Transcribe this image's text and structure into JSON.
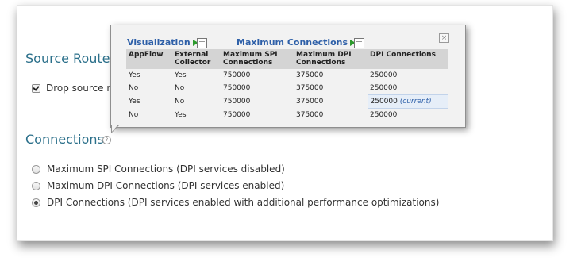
{
  "sections": {
    "source_routed": {
      "title": "Source Routed Pa",
      "checkbox_label": "Drop source routed packets",
      "checked": true
    },
    "connections": {
      "title": "Connections",
      "help_icon": "help-icon",
      "options": [
        {
          "label": "Maximum SPI Connections (DPI services disabled)",
          "selected": false
        },
        {
          "label": "Maximum DPI Connections (DPI services enabled)",
          "selected": false
        },
        {
          "label": "DPI Connections (DPI services enabled with additional performance optimizations)",
          "selected": true
        }
      ]
    }
  },
  "popup": {
    "links": {
      "visualization": "Visualization",
      "maximum_connections": "Maximum Connections"
    },
    "export_icon": "export-icon",
    "close_glyph": "×",
    "table": {
      "headers": [
        "AppFlow",
        "External Collector",
        "Maximum SPI Connections",
        "Maximum DPI Connections",
        "DPI Connections"
      ],
      "rows": [
        {
          "appflow": "Yes",
          "collector": "Yes",
          "spi": "750000",
          "max_dpi": "375000",
          "dpi": "250000",
          "tag": ""
        },
        {
          "appflow": "No",
          "collector": "No",
          "spi": "750000",
          "max_dpi": "375000",
          "dpi": "250000",
          "tag": ""
        },
        {
          "appflow": "Yes",
          "collector": "No",
          "spi": "750000",
          "max_dpi": "375000",
          "dpi": "250000",
          "tag": "(current)"
        },
        {
          "appflow": "No",
          "collector": "Yes",
          "spi": "750000",
          "max_dpi": "375000",
          "dpi": "250000",
          "tag": ""
        }
      ]
    }
  },
  "colors": {
    "section_title": "#2a6f8a",
    "link": "#2d5fa8",
    "header_bg": "#d4d4d4",
    "current_row_bg": "#e6eef8"
  }
}
